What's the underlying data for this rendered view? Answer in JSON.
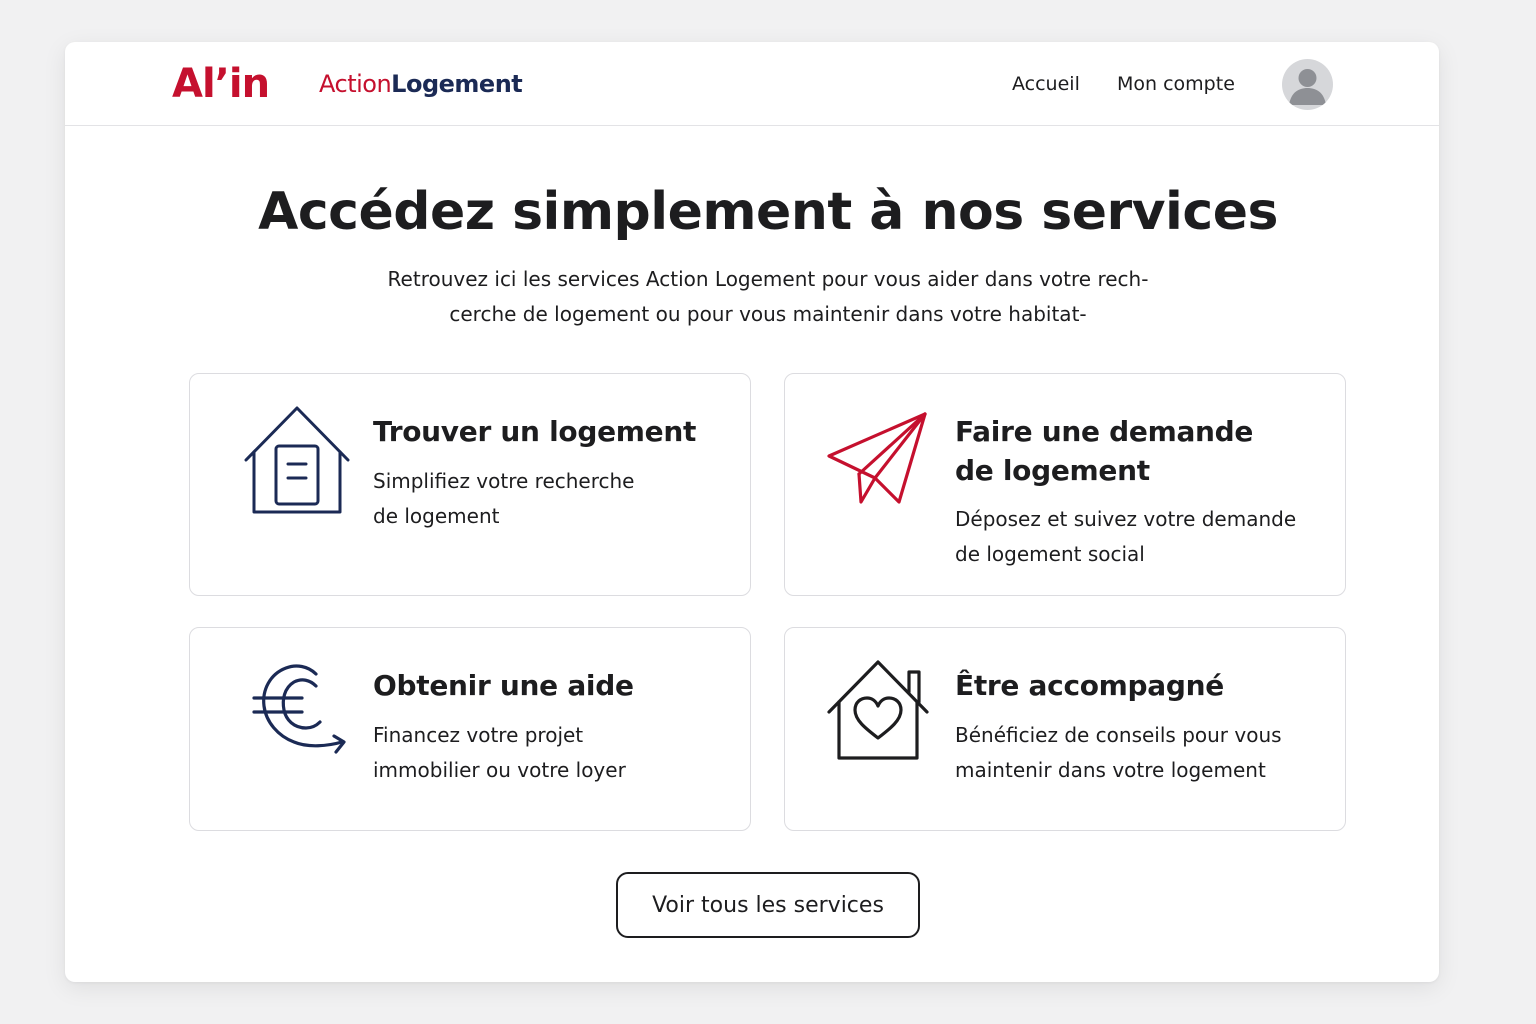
{
  "header": {
    "logo_alin": "Al’in",
    "logo_action": "Action",
    "logo_logement": "Logement",
    "nav": [
      {
        "label": "Accueil"
      },
      {
        "label": "Mon compte"
      }
    ],
    "avatar_icon": "user-avatar-icon"
  },
  "hero": {
    "title": "Accédez simplement à nos services",
    "subtitle_lines": [
      "Retrouvez ici les services Action Logement pour vous aider dans votre rech-",
      "cerche de logement ou pour vous maintenir dans votre habitat-"
    ]
  },
  "cards": [
    {
      "icon": "house-document-icon",
      "title_lines": [
        "Trouver un logement"
      ],
      "desc_lines": [
        "Simplifiez votre recherche",
        "de logement"
      ]
    },
    {
      "icon": "paper-plane-icon",
      "title_lines": [
        "Faire une demande",
        "de logement"
      ],
      "desc_lines": [
        "Déposez et suivez votre demande",
        "de logement social"
      ]
    },
    {
      "icon": "euro-arrow-icon",
      "title_lines": [
        "Obtenir une aide"
      ],
      "desc_lines": [
        "Financez votre projet",
        "immobilier ou votre loyer"
      ]
    },
    {
      "icon": "house-heart-icon",
      "title_lines": [
        "Être accompagné"
      ],
      "desc_lines": [
        "Bénéficiez de conseils pour vous",
        "maintenir dans votre logement"
      ]
    }
  ],
  "cta": {
    "label": "Voir tous les services"
  },
  "colors": {
    "brand_red": "#c5102e",
    "brand_navy": "#1b2a55",
    "text": "#1d1d1f",
    "border": "#dcdce0"
  }
}
